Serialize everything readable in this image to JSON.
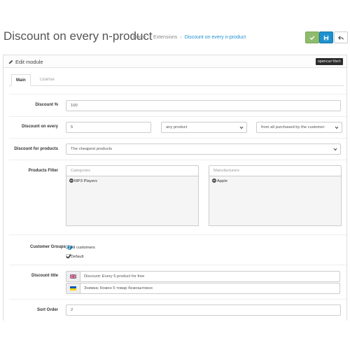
{
  "header": {
    "title": "Discount on every n-product",
    "breadcrumb": [
      "Home",
      "Extensions",
      "Discount on every n-product"
    ]
  },
  "panel": {
    "title": "Edit module",
    "badge": "opencartbot"
  },
  "tabs": [
    {
      "label": "Main",
      "active": true
    },
    {
      "label": "License",
      "active": false
    }
  ],
  "form": {
    "discount_percent": {
      "label": "Discount %",
      "value": "100"
    },
    "discount_on_every": {
      "label": "Discount on every",
      "value": "5",
      "product_select": "any product",
      "scope_select": "from all purchased by the customer"
    },
    "discount_for_products": {
      "label": "Discount for products",
      "value": "The cheapest products"
    },
    "products_filter": {
      "label": "Products Filter",
      "categories_placeholder": "Categories",
      "manufacturers_placeholder": "Manufacturers",
      "categories": [
        "MP3 Players"
      ],
      "manufacturers": [
        "Apple"
      ]
    },
    "customer_groups": {
      "label": "Customer Groups",
      "options": [
        {
          "label": "All customers",
          "checked": false
        },
        {
          "label": "Default",
          "checked": true
        }
      ]
    },
    "discount_title": {
      "label": "Discount title",
      "values": [
        {
          "flag": "uk-flag-icon",
          "text": "Discount: Every 5 product for free"
        },
        {
          "flag": "ua-flag-icon",
          "text": "Знижка: Кожен 5 товар безкоштовно"
        }
      ]
    },
    "sort_order": {
      "label": "Sort Order",
      "value": "2"
    }
  },
  "colors": {
    "accent": "#1e91cf",
    "success": "#8fbb6c",
    "badge_bg": "#2b2b2b"
  }
}
